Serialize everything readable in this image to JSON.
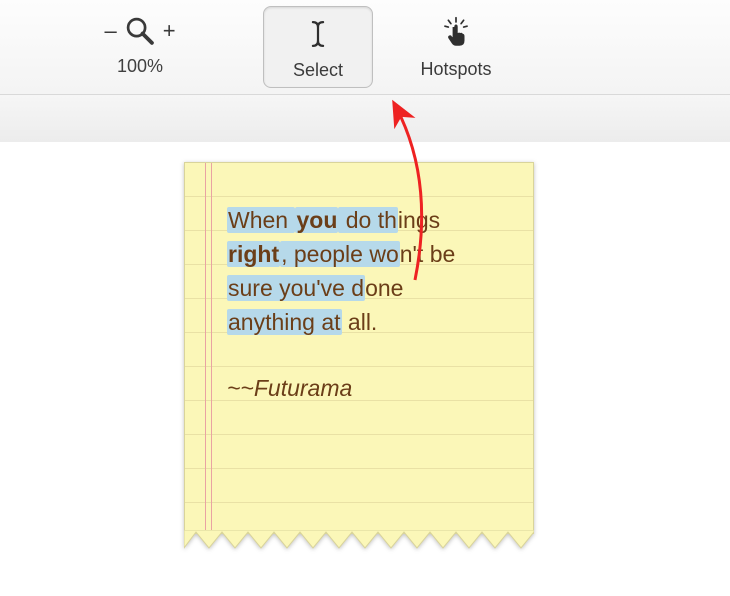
{
  "toolbar": {
    "zoom": {
      "minus": "–",
      "plus": "+",
      "level": "100%"
    },
    "select": {
      "label": "Select"
    },
    "hotspots": {
      "label": "Hotspots"
    }
  },
  "note": {
    "line_parts": {
      "p1": "When ",
      "p2": "you",
      "p3": " do th",
      "p4": "ings",
      "p5": "right",
      "p6": ", people wo",
      "p7": "n't be",
      "p8": "sure you've d",
      "p9": "one",
      "p10": "anything at",
      "p11": " all."
    },
    "attribution": "~~Futurama"
  }
}
